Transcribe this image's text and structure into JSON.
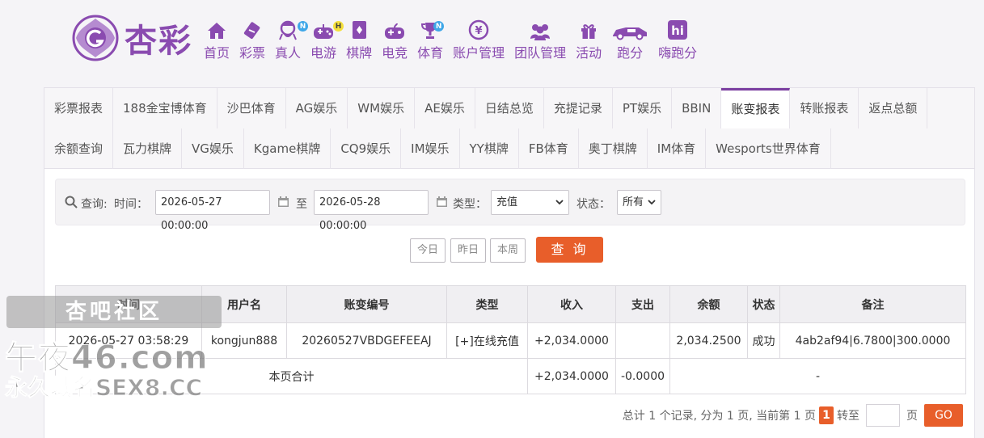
{
  "brand": {
    "logo_text": "杏彩",
    "color": "#8a4bb0"
  },
  "nav": [
    {
      "label": "首页",
      "icon": "home-icon"
    },
    {
      "label": "彩票",
      "icon": "lottery-ticket-icon"
    },
    {
      "label": "真人",
      "icon": "live-dealer-icon",
      "badge": "N"
    },
    {
      "label": "电游",
      "icon": "gamepad-icon",
      "badge": "H"
    },
    {
      "label": "棋牌",
      "icon": "cards-icon"
    },
    {
      "label": "电竞",
      "icon": "esports-controller-icon"
    },
    {
      "label": "体育",
      "icon": "trophy-icon",
      "badge": "N"
    },
    {
      "label": "账户管理",
      "icon": "account-yen-icon"
    },
    {
      "label": "团队管理",
      "icon": "team-icon"
    },
    {
      "label": "活动",
      "icon": "gift-icon"
    },
    {
      "label": "跑分",
      "icon": "running-car-icon"
    },
    {
      "label": "嗨跑分",
      "icon": "hi-app-icon"
    }
  ],
  "tabs_row1": [
    "彩票报表",
    "188金宝博体育",
    "沙巴体育",
    "AG娱乐",
    "WM娱乐",
    "AE娱乐",
    "日结总览",
    "充提记录",
    "PT娱乐",
    "BBIN",
    "账变报表",
    "转账报表",
    "返点总额"
  ],
  "tabs_row2": [
    "余额查询",
    "瓦力棋牌",
    "VG娱乐",
    "Kgame棋牌",
    "CQ9娱乐",
    "IM娱乐",
    "YY棋牌",
    "FB体育",
    "奥丁棋牌",
    "IM体育",
    "Wesports世界体育"
  ],
  "active_tab": "账变报表",
  "query": {
    "label": "查询:",
    "time_label": "时间：",
    "start": "2026-05-27 00:00:00",
    "to": "至",
    "end": "2026-05-28 00:00:00",
    "type_label": "类型：",
    "type_value": "充值",
    "status_label": "状态：",
    "status_value": "所有"
  },
  "quick_buttons": [
    "今日",
    "昨日",
    "本周"
  ],
  "submit_label": "查 询",
  "table": {
    "headers": [
      "时间",
      "用户名",
      "账变编号",
      "类型",
      "收入",
      "支出",
      "余额",
      "状态",
      "备注"
    ],
    "rows": [
      [
        "2026-05-27 03:58:29",
        "kongjun888",
        "20260527VBDGEFEEAJ",
        "[+]在线充值",
        "+2,034.0000",
        "",
        "2,034.2500",
        "成功",
        "4ab2af94|6.7800|300.0000"
      ]
    ],
    "summary": {
      "label": "本页合计",
      "income": "+2,034.0000",
      "expense": "-0.0000",
      "rest": "-"
    }
  },
  "pager": {
    "text": "总计 1 个记录, 分为 1 页, 当前第 1 页",
    "current": "1",
    "goto": "转至",
    "page_unit": "页",
    "go": "GO"
  },
  "watermark": {
    "line1": "杏吧社区",
    "line2": "午夜46.com",
    "line3": "永久域名SEX8.CC"
  },
  "colors": {
    "accent": "#7b3fa0",
    "orange": "#e85e2a",
    "income_green": "#4caf50"
  }
}
